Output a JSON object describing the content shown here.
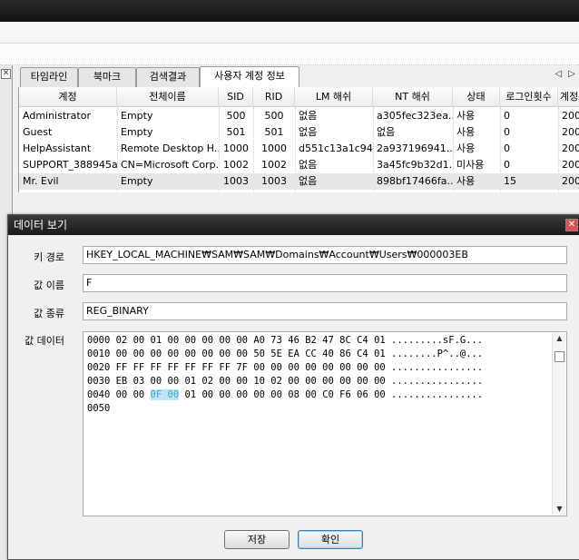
{
  "tabs": [
    {
      "label": "타임라인"
    },
    {
      "label": "북마크"
    },
    {
      "label": "검색결과"
    },
    {
      "label": "사용자 계정 정보"
    }
  ],
  "tab_arrows": "◁ ▷",
  "left_close": "✕",
  "table": {
    "columns": [
      "계정",
      "전체이름",
      "SID",
      "RID",
      "LM 해쉬",
      "NT 해쉬",
      "상태",
      "로그인횟수",
      "계정"
    ],
    "rows": [
      [
        "Administrator",
        "Empty",
        "500",
        "500",
        "없음",
        "a305fec323ea...",
        "사용",
        "0",
        "200"
      ],
      [
        "Guest",
        "Empty",
        "501",
        "501",
        "없음",
        "없음",
        "사용",
        "0",
        "200"
      ],
      [
        "HelpAssistant",
        "Remote Desktop H...",
        "1000",
        "1000",
        "d551c13a1c94...",
        "2a937196941...",
        "사용",
        "0",
        "200"
      ],
      [
        "SUPPORT_388945a0",
        "CN=Microsoft Corp...",
        "1002",
        "1002",
        "없음",
        "3a45fc9b32d1...",
        "미사용",
        "0",
        "200"
      ],
      [
        "Mr. Evil",
        "Empty",
        "1003",
        "1003",
        "없음",
        "898bf17466fa...",
        "사용",
        "15",
        "200"
      ]
    ]
  },
  "dialog": {
    "title": "데이터 보기",
    "close": "✕",
    "key_path_label": "키 경로",
    "key_path": "HKEY_LOCAL_MACHINE₩SAM₩SAM₩Domains₩Account₩Users₩000003EB",
    "value_name_label": "값 이름",
    "value_name": "F",
    "value_type_label": "값 종류",
    "value_type": "REG_BINARY",
    "value_data_label": "값 데이터",
    "hex_lines": [
      {
        "pre": "0000 02 00 01 00 00 00 00 00 A0 73 46 B2 47 8C C4 01 .........sF.G...",
        "hl": "",
        "post": ""
      },
      {
        "pre": "0010 00 00 00 00 00 00 00 00 50 5E EA CC 40 86 C4 01 ........P^..@...",
        "hl": "",
        "post": ""
      },
      {
        "pre": "0020 FF FF FF FF FF FF FF 7F 00 00 00 00 00 00 00 00 ................",
        "hl": "",
        "post": ""
      },
      {
        "pre": "0030 EB 03 00 00 01 02 00 00 10 02 00 00 00 00 00 00 ................",
        "hl": "",
        "post": ""
      },
      {
        "pre": "0040 00 00 ",
        "hl": "0F 00",
        "post": " 01 00 00 00 00 00 08 00 C0 F6 06 00 ................"
      },
      {
        "pre": "0050",
        "hl": "",
        "post": ""
      }
    ],
    "save_label": "저장",
    "ok_label": "확인"
  }
}
